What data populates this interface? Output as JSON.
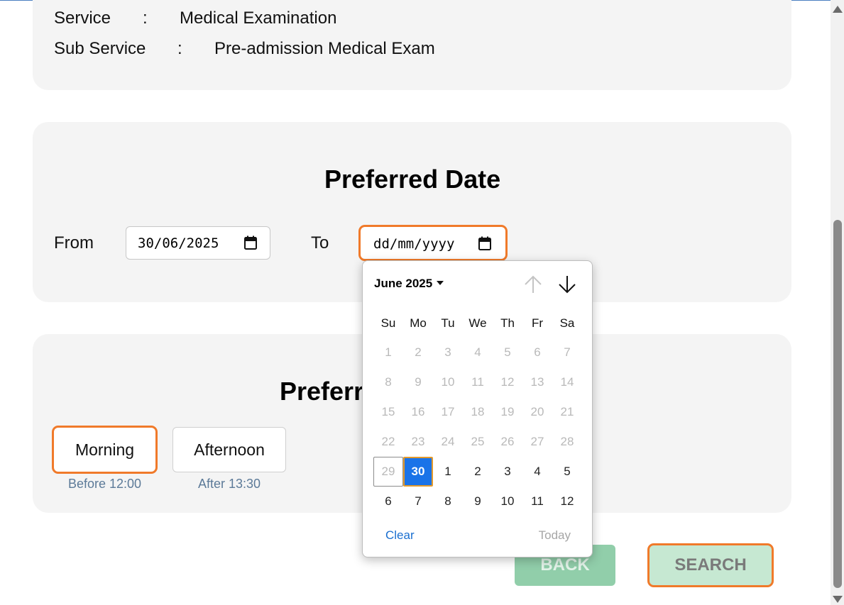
{
  "info": {
    "service_label": "Service",
    "service_sep": ":",
    "service_value": "Medical Examination",
    "subservice_label": "Sub Service",
    "subservice_sep": ":",
    "subservice_value": "Pre-admission Medical Exam"
  },
  "date_section": {
    "title": "Preferred Date",
    "from_label": "From",
    "from_value": "30/06/2025",
    "to_label": "To",
    "to_value": "dd/mm/yyyy"
  },
  "time_section": {
    "title": "Preferr",
    "slots": [
      {
        "label": "Morning",
        "sub": "Before 12:00",
        "selected": true
      },
      {
        "label": "Afternoon",
        "sub": "After 13:30",
        "selected": false
      }
    ]
  },
  "buttons": {
    "back": "BACK",
    "search": "SEARCH"
  },
  "datepicker": {
    "month_label": "June 2025",
    "weekdays": [
      "Su",
      "Mo",
      "Tu",
      "We",
      "Th",
      "Fr",
      "Sa"
    ],
    "weeks": [
      [
        "1",
        "2",
        "3",
        "4",
        "5",
        "6",
        "7"
      ],
      [
        "8",
        "9",
        "10",
        "11",
        "12",
        "13",
        "14"
      ],
      [
        "15",
        "16",
        "17",
        "18",
        "19",
        "20",
        "21"
      ],
      [
        "22",
        "23",
        "24",
        "25",
        "26",
        "27",
        "28"
      ],
      [
        "29",
        "30",
        "1",
        "2",
        "3",
        "4",
        "5"
      ],
      [
        "6",
        "7",
        "8",
        "9",
        "10",
        "11",
        "12"
      ]
    ],
    "selected_day": "30",
    "today_day": "29",
    "clear_label": "Clear",
    "today_label": "Today",
    "accent_color": "#1a73e8",
    "focus_color": "#f07a2a"
  }
}
